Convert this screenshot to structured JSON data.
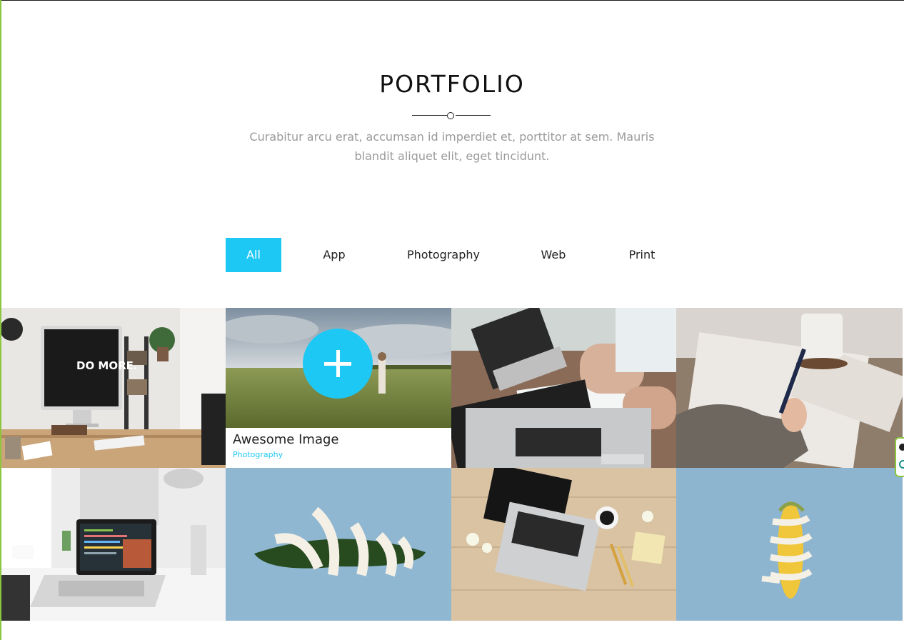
{
  "portfolio": {
    "title": "PORTFOLIO",
    "intro": "Curabitur arcu erat, accumsan id imperdiet et, porttitor at sem. Mauris blandit aliquet elit, eget tincidunt."
  },
  "filters": [
    "All",
    "App",
    "Photography",
    "Web",
    "Print"
  ],
  "active_filter": "All",
  "hover_item": {
    "title": "Awesome Image",
    "category": "Photography"
  },
  "colors": {
    "accent": "#1ec8f5",
    "frame_green": "#8cc63f"
  },
  "gallery_items": [
    {
      "subject": "desk with imac \"DO MORE.\"",
      "text": "DO MORE."
    },
    {
      "subject": "woman standing in grass field"
    },
    {
      "subject": "hands writing beside laptop"
    },
    {
      "subject": "hand writing in notebook with mug"
    },
    {
      "subject": "laptop on white desk with code"
    },
    {
      "subject": "cucumber with measuring tape"
    },
    {
      "subject": "laptop and coffee on wooden desk"
    },
    {
      "subject": "corn with measuring tape"
    }
  ]
}
